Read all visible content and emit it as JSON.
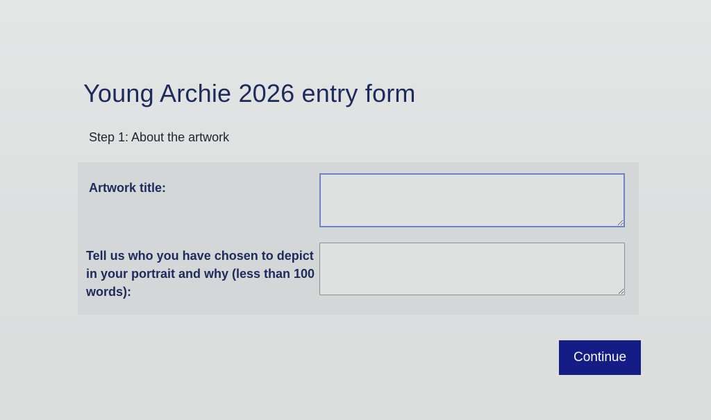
{
  "form": {
    "title": "Young Archie 2026 entry form",
    "step": "Step 1: About the artwork",
    "fields": [
      {
        "label": "Artwork title:",
        "value": ""
      },
      {
        "label": "Tell us who you have chosen to depict in your portrait and why (less than 100 words):",
        "value": ""
      }
    ],
    "continue_label": "Continue"
  },
  "colors": {
    "heading": "#1f2a5c",
    "button": "#141c86",
    "focus_border": "#6f82c4"
  }
}
